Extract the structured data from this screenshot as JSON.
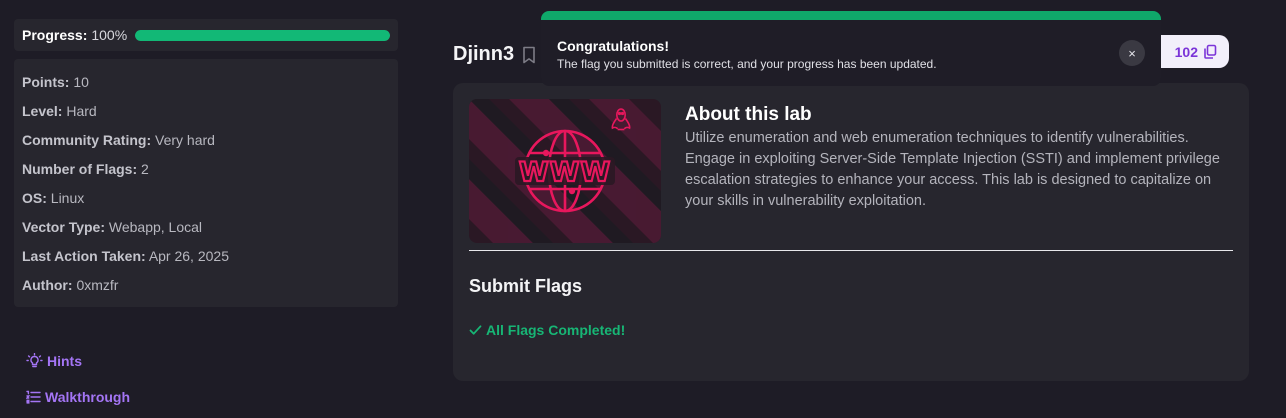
{
  "sidebar": {
    "progress": {
      "label": "Progress:",
      "value": "100%",
      "fraction": 1.0
    },
    "details": [
      {
        "key": "Points:",
        "value": "10"
      },
      {
        "key": "Level:",
        "value": "Hard"
      },
      {
        "key": "Community Rating:",
        "value": "Very hard"
      },
      {
        "key": "Number of Flags:",
        "value": "2"
      },
      {
        "key": "OS:",
        "value": "Linux"
      },
      {
        "key": "Vector Type:",
        "value": "Webapp, Local"
      },
      {
        "key": "Last Action Taken:",
        "value": "Apr 26, 2025"
      },
      {
        "key": "Author:",
        "value": "0xmzfr"
      }
    ],
    "links": {
      "hints": "Hints",
      "walkthrough": "Walkthrough"
    }
  },
  "lab": {
    "title": "Djinn3",
    "ip_fragment": "102",
    "about_title": "About this lab",
    "about_text": "Utilize enumeration and web enumeration techniques to identify vulnerabilities. Engage in exploiting Server-Side Template Injection (SSTI) and implement privilege escalation strategies to enhance your access. This lab is designed to capitalize on your skills in vulnerability exploitation.",
    "image_text": "WWW",
    "submit_title": "Submit Flags",
    "completed_text": "All Flags Completed!"
  },
  "toast": {
    "title": "Congratulations!",
    "message": "The flag you submitted is correct, and your progress has been updated.",
    "close_glyph": "×"
  },
  "colors": {
    "accent_green": "#12b876",
    "accent_purple": "#a475f5",
    "brand_pink": "#e8175d"
  },
  "icons": [
    "bookmark-icon",
    "copy-icon",
    "lightbulb-icon",
    "list-icon",
    "check-icon",
    "close-icon",
    "linux-icon",
    "globe-icon"
  ]
}
